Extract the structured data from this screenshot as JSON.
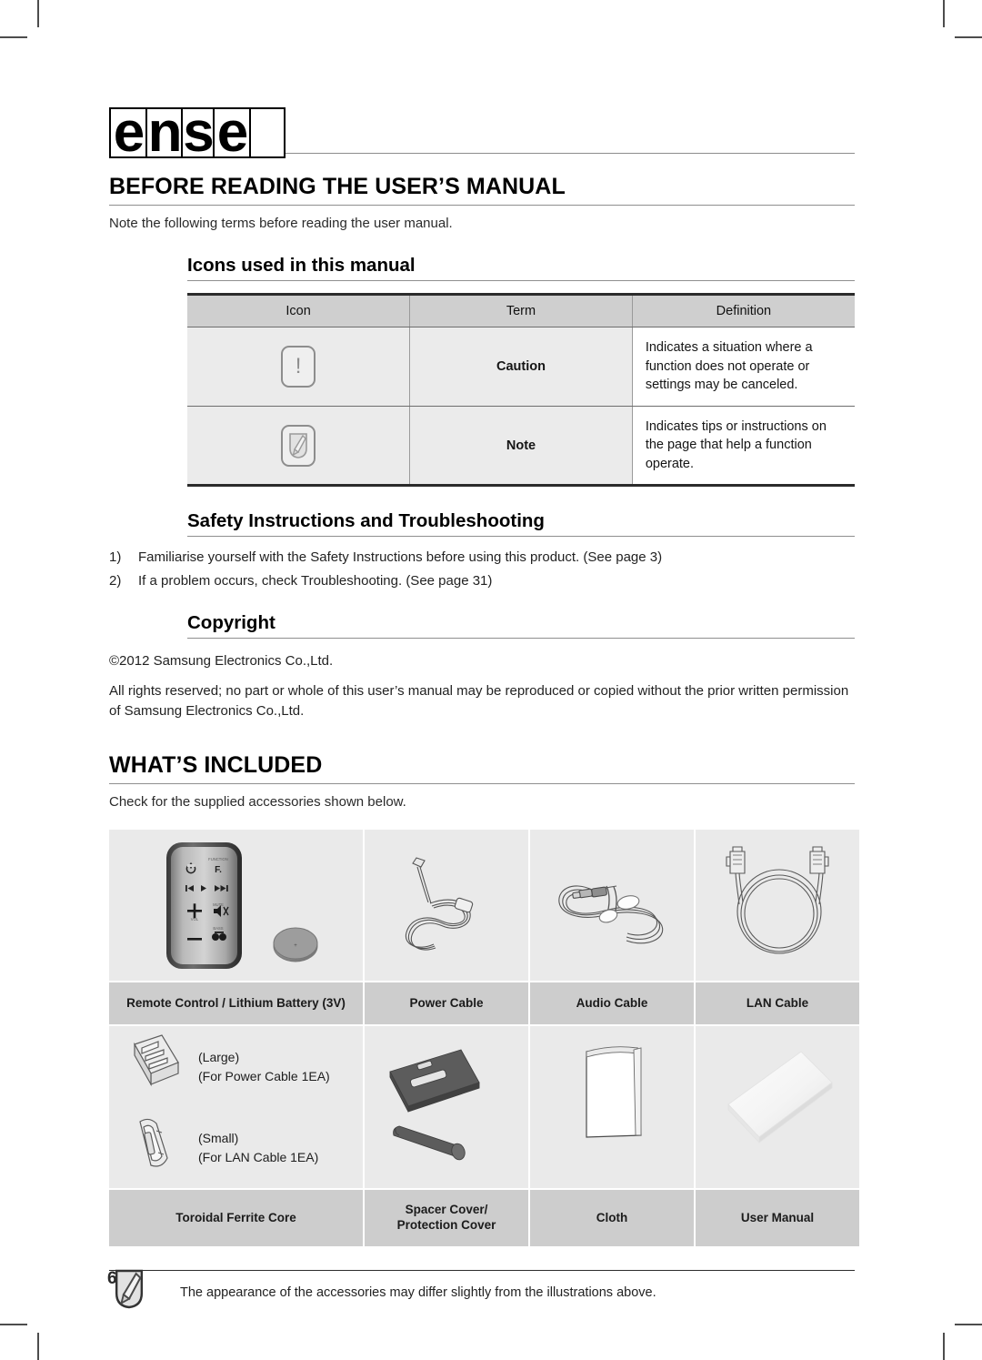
{
  "masthead": {
    "glyphs": [
      "e",
      "n",
      "s",
      "e",
      ""
    ],
    "note": "tofu-boxed brand lettering"
  },
  "section_before_reading": {
    "title": "BEFORE READING THE USER’S MANUAL",
    "intro": "Note the following terms before reading the user manual.",
    "sub_icons": {
      "title": "Icons used in this manual",
      "table": {
        "headers": [
          "Icon",
          "Term",
          "Definition"
        ],
        "rows": [
          {
            "icon": "caution-icon",
            "term": "Caution",
            "definition": "Indicates a situation where a function does not operate or settings may be canceled."
          },
          {
            "icon": "note-icon",
            "term": "Note",
            "definition": "Indicates tips or instructions on the page that help a function operate."
          }
        ]
      }
    },
    "sub_safety": {
      "title": "Safety Instructions and Troubleshooting",
      "steps": [
        {
          "num": "1)",
          "text": "Familiarise yourself with the Safety Instructions before using this product. (See page 3)"
        },
        {
          "num": "2)",
          "text": "If a problem occurs, check Troubleshooting. (See page 31)"
        }
      ]
    },
    "sub_copyright": {
      "title": "Copyright",
      "line": "©2012 Samsung Electronics Co.,Ltd.",
      "paragraph": "All rights reserved; no part or whole of this user’s manual may be reproduced or copied without the prior written permission of Samsung Electronics Co.,Ltd."
    }
  },
  "section_whats_included": {
    "title": "WHAT’S INCLUDED",
    "intro": "Check for the supplied accessories shown below.",
    "accessories": [
      {
        "id": "remote-control",
        "label": "Remote Control / Lithium Battery (3V)"
      },
      {
        "id": "power-cable",
        "label": "Power Cable"
      },
      {
        "id": "audio-cable",
        "label": "Audio Cable"
      },
      {
        "id": "lan-cable",
        "label": "LAN Cable"
      },
      {
        "id": "ferrite-core",
        "label": "Toroidal Ferrite Core"
      },
      {
        "id": "spacer-cover",
        "label": "Spacer Cover/\nProtection Cover",
        "label_line1": "Spacer Cover/",
        "label_line2": "Protection Cover"
      },
      {
        "id": "cloth",
        "label": "Cloth"
      },
      {
        "id": "user-manual",
        "label": "User Manual"
      }
    ],
    "ferrite_details": [
      {
        "size": "(Large)",
        "usage": "(For Power Cable 1EA)"
      },
      {
        "size": "(Small)",
        "usage": "(For LAN Cable 1EA)"
      }
    ],
    "remote_button_labels": {
      "function": "FUNCTION",
      "vol": "VOL",
      "mute": "MUTE",
      "bass": "BASS",
      "function_key": "F."
    }
  },
  "footer": {
    "note_icon": "note-icon",
    "note_text": "The appearance of the accessories may differ slightly from the illustrations above.",
    "page_number": "6"
  },
  "colors": {
    "header_band": "#cfcfcf",
    "cell_bg": "#ebebeb",
    "accessory_bg": "#eaeaea",
    "accessory_label_bg": "#cdcdcd",
    "rule": "#8f8f8f",
    "text": "#1a1a1a"
  }
}
